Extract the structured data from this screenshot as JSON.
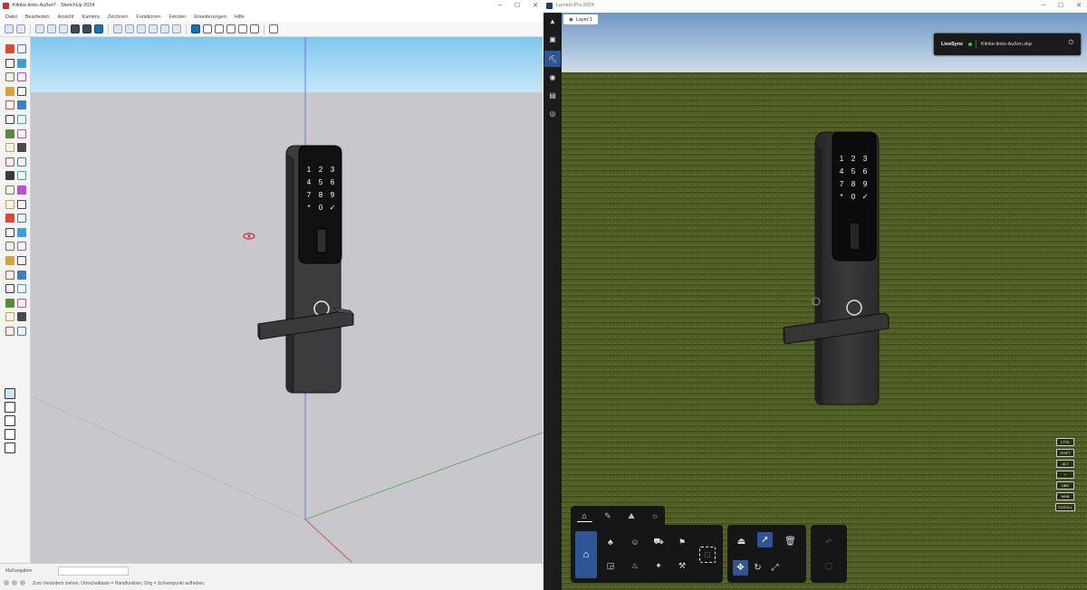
{
  "sketchup": {
    "title": "Klinke-links-Außen* - SketchUp 2024",
    "menu": [
      "Datei",
      "Bearbeiten",
      "Ansicht",
      "Kamera",
      "Zeichnen",
      "Funktionen",
      "Fenster",
      "Erweiterungen",
      "Hilfe"
    ],
    "status": {
      "measure_label": "Maßangaben",
      "measure_value": "",
      "hint": "Zum Verändern ziehen. Umschalttaste = Handfunktion, Strg = Schwerpunkt aufheben."
    }
  },
  "lumion": {
    "title": "Lumion Pro 2024",
    "layer_tab": "Layer 1",
    "livesync": {
      "label": "LiveSync",
      "file": "Klinke-links-Außen.skp",
      "status_color": "#35c24a"
    },
    "keyboard_indicators": [
      "CTRL",
      "SHIFT",
      "ALT",
      "+",
      "OBD",
      "NMB",
      "SCROLL"
    ]
  },
  "model": {
    "keypad_rows": [
      [
        "1",
        "2",
        "3"
      ],
      [
        "4",
        "5",
        "6"
      ],
      [
        "7",
        "8",
        "9"
      ],
      [
        "*",
        "0",
        "✓"
      ]
    ]
  },
  "colors": {
    "sky": "#a9dbf4",
    "ground": "#c8c7cc",
    "lumion_accent": "#2f5596",
    "lock_body": "#3a3a3a"
  }
}
